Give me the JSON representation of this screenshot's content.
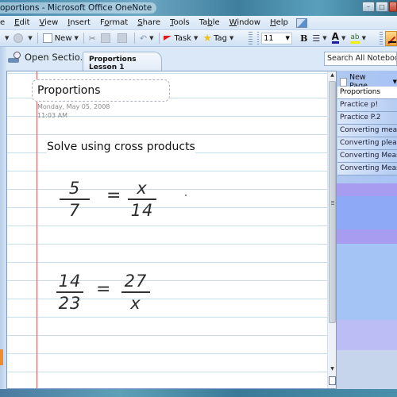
{
  "window": {
    "title": "Proportions - Microsoft Office OneNote",
    "title_visible": "oportions - Microsoft Office OneNote",
    "controls": [
      "minimize",
      "maximize",
      "close"
    ]
  },
  "menubar": {
    "items": [
      {
        "label": "e",
        "accel": ""
      },
      {
        "label": "Edit",
        "accel": "E"
      },
      {
        "label": "View",
        "accel": "V"
      },
      {
        "label": "Insert",
        "accel": "I"
      },
      {
        "label": "Format",
        "accel": "o"
      },
      {
        "label": "Share",
        "accel": "S"
      },
      {
        "label": "Tools",
        "accel": "T"
      },
      {
        "label": "Table",
        "accel": "b"
      },
      {
        "label": "Window",
        "accel": "W"
      },
      {
        "label": "Help",
        "accel": "H"
      }
    ]
  },
  "toolbar": {
    "new_label": "New",
    "task_label": "Task",
    "tag_label": "Tag",
    "font_size": "11",
    "bold_label": "B"
  },
  "tabs": {
    "open_sections_label": "Open Sectio...",
    "active_section": "Proportions Lesson 1",
    "search_placeholder": "Search All Notebooks"
  },
  "page": {
    "title": "Proportions",
    "date": "Monday, May 05, 2008",
    "time": "11:03 AM",
    "body_text": "Solve using cross products",
    "handwriting": [
      {
        "left_num": "5",
        "left_den": "7",
        "op": "=",
        "right_num": "x",
        "right_den": "14"
      },
      {
        "left_num": "14",
        "left_den": "23",
        "op": "=",
        "right_num": "27",
        "right_den": "x"
      }
    ]
  },
  "pages_panel": {
    "new_page_label": "New Page",
    "pages": [
      {
        "label": "Proportions",
        "active": true
      },
      {
        "label": "Practice p!",
        "active": false
      },
      {
        "label": "Practice P.2",
        "active": false
      },
      {
        "label": "Converting measu",
        "active": false
      },
      {
        "label": "Converting pleasu",
        "active": false
      },
      {
        "label": "Converting Measu",
        "active": false
      },
      {
        "label": "Converting Measu",
        "active": false
      }
    ]
  },
  "colors": {
    "margin_line": "#d76060",
    "rule_line": "#c6dfe8",
    "panel_blue": "#a8c4f4",
    "panel_purple": "#a79cf0"
  }
}
